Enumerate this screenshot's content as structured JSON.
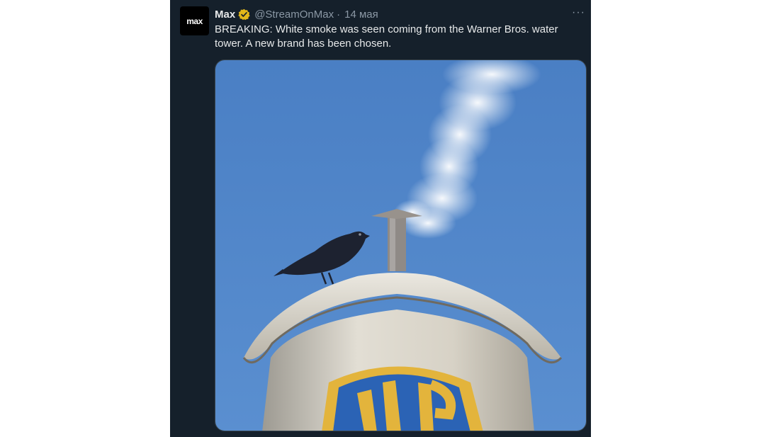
{
  "tweet": {
    "display_name": "Max",
    "handle": "@StreamOnMax",
    "separator": "·",
    "date": "14 мая",
    "more_label": "···",
    "avatar_text": "max",
    "text": "BREAKING: White smoke was seen coming from the Warner Bros. water tower. A new brand has been chosen.",
    "verified_icon": "verified-badge-gold",
    "media_alt_icon": "photo-water-tower-smoke"
  },
  "colors": {
    "background": "#15202b",
    "text": "#e7e9ea",
    "secondary": "#8b98a5",
    "verified": "#e2b719",
    "sky": "#4f84c8"
  }
}
